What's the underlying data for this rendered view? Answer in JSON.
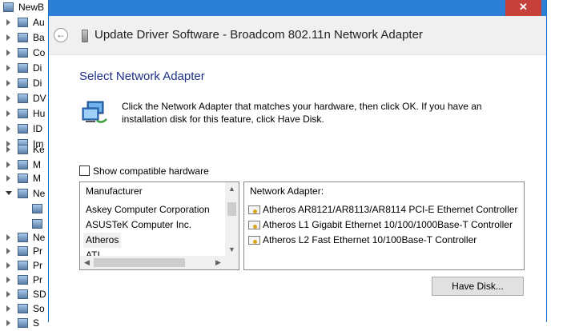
{
  "tree": {
    "root_label": "NewB",
    "items": [
      "Au",
      "Ba",
      "Co",
      "Di",
      "Di",
      "DV",
      "Hu",
      "ID",
      "Im",
      "Ke",
      "M",
      "M",
      "Ne",
      "",
      "",
      "Ne",
      "Pr",
      "Pr",
      "Pr",
      "SD",
      "So",
      "S"
    ]
  },
  "dialog": {
    "title": "Update Driver Software - Broadcom 802.11n Network Adapter",
    "close_glyph": "✕",
    "back_glyph": "←",
    "section_title": "Select Network Adapter",
    "instructions": "Click the Network Adapter that matches your hardware, then click OK. If you have an installation disk for this feature, click Have Disk.",
    "show_compatible_label": "Show compatible hardware",
    "show_compatible_checked": false,
    "manufacturer_header": "Manufacturer",
    "manufacturers": [
      "Askey Computer Corporation",
      "ASUSTeK Computer Inc.",
      "Atheros",
      "ATI"
    ],
    "selected_manufacturer": "Atheros",
    "adapter_header": "Network Adapter:",
    "adapters": [
      "Atheros AR8121/AR8113/AR8114 PCI-E Ethernet Controller",
      "Atheros L1 Gigabit Ethernet 10/100/1000Base-T Controller",
      "Atheros L2 Fast Ethernet 10/100Base-T Controller"
    ],
    "have_disk_label": "Have Disk..."
  },
  "colors": {
    "accent": "#2b7fd6",
    "close": "#c7413b",
    "section_title": "#1e3287"
  }
}
